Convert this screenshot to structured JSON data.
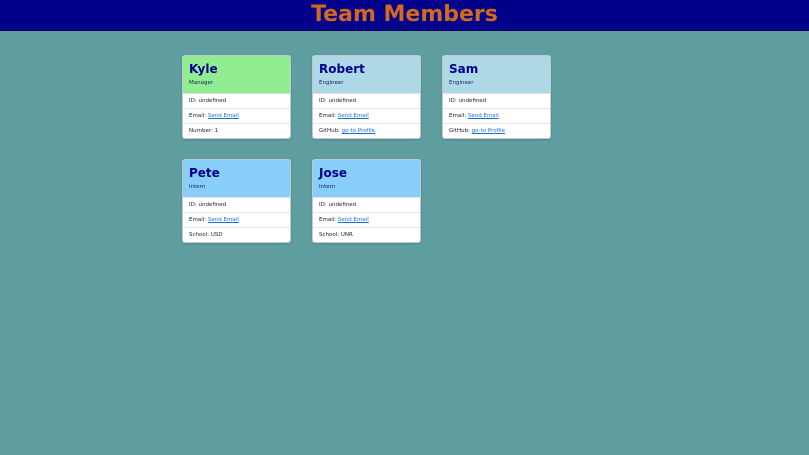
{
  "header": {
    "title": "Team Members"
  },
  "colors": {
    "page_bg": "#5f9ea0",
    "header_bg": "#00008b",
    "title": "#d2691e",
    "manager_card": "#90ee90",
    "engineer_card": "#add8e6",
    "intern_card": "#87cefa",
    "link": "#1a6fd6"
  },
  "cards": [
    {
      "name": "Kyle",
      "role": "Manager",
      "id_label": "ID:",
      "id_value": "undefined",
      "email_label": "Email:",
      "email_link": "Send Email",
      "extra_label": "Number:",
      "extra_value": "1"
    },
    {
      "name": "Robert",
      "role": "Engineer",
      "id_label": "ID:",
      "id_value": "undefined",
      "email_label": "Email:",
      "email_link": "Send Email",
      "extra_label": "GitHub:",
      "extra_link": "go-to Profile"
    },
    {
      "name": "Sam",
      "role": "Engineer",
      "id_label": "ID:",
      "id_value": "undefined",
      "email_label": "Email:",
      "email_link": "Send Email",
      "extra_label": "GitHub:",
      "extra_link": "go-to Profile"
    },
    {
      "name": "Pete",
      "role": "Intern",
      "id_label": "ID:",
      "id_value": "undefined",
      "email_label": "Email:",
      "email_link": "Send Email",
      "extra_label": "School:",
      "extra_value": "USD"
    },
    {
      "name": "Jose",
      "role": "Intern",
      "id_label": "ID:",
      "id_value": "undefined",
      "email_label": "Email:",
      "email_link": "Send Email",
      "extra_label": "School:",
      "extra_value": "UNR"
    }
  ]
}
